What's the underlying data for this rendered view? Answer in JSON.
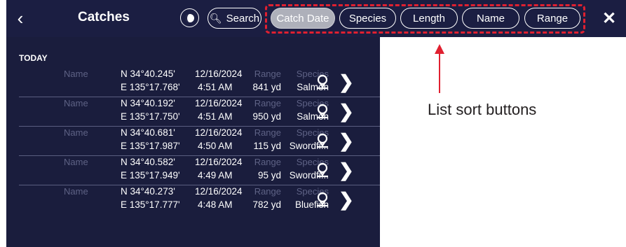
{
  "header": {
    "title": "Catches",
    "back_icon": "chevron-left-icon",
    "theme_icon": "day-night-icon",
    "search_label": "Search",
    "close_icon": "close-icon"
  },
  "sort_buttons": [
    {
      "label": "Catch Date",
      "active": true
    },
    {
      "label": "Species",
      "active": false
    },
    {
      "label": "Length",
      "active": false
    },
    {
      "label": "Name",
      "active": false
    },
    {
      "label": "Range",
      "active": false
    }
  ],
  "section_label": "TODAY",
  "rows": [
    {
      "name": "Name",
      "lat": "N 34°40.245'",
      "date": "12/16/2024",
      "lon": "E 135°17.768'",
      "time": "4:51 AM",
      "range_label": "Range",
      "range": "841 yd",
      "species_label": "Species",
      "species": "Salmon"
    },
    {
      "name": "Name",
      "lat": "N 34°40.192'",
      "date": "12/16/2024",
      "lon": "E 135°17.750'",
      "time": "4:51 AM",
      "range_label": "Range",
      "range": "950 yd",
      "species_label": "Species",
      "species": "Salmon"
    },
    {
      "name": "Name",
      "lat": "N 34°40.681'",
      "date": "12/16/2024",
      "lon": "E 135°17.987'",
      "time": "4:50 AM",
      "range_label": "Range",
      "range": "115 yd",
      "species_label": "Species",
      "species": "Swordfi..."
    },
    {
      "name": "Name",
      "lat": "N 34°40.582'",
      "date": "12/16/2024",
      "lon": "E 135°17.949'",
      "time": "4:49 AM",
      "range_label": "Range",
      "range": "95 yd",
      "species_label": "Species",
      "species": "Swordfi..."
    },
    {
      "name": "Name",
      "lat": "N 34°40.273'",
      "date": "12/16/2024",
      "lon": "E 135°17.777'",
      "time": "4:48 AM",
      "range_label": "Range",
      "range": "782 yd",
      "species_label": "Species",
      "species": "Bluefish"
    }
  ],
  "annotation": {
    "callout_text": "List sort buttons",
    "highlight_color": "#e02030"
  },
  "colors": {
    "background": "#1a1d3d",
    "active_chip": "#aeb0ba",
    "muted_text": "#5e6285"
  }
}
